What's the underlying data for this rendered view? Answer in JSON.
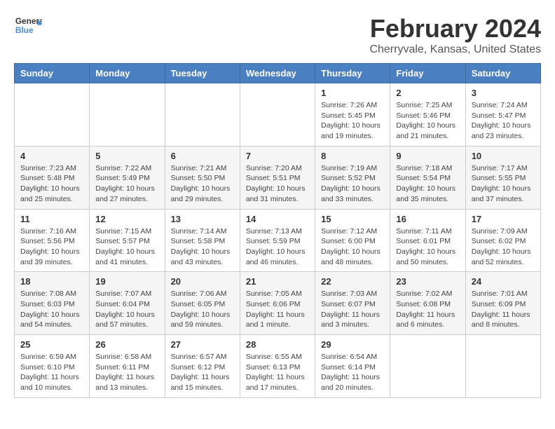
{
  "logo": {
    "line1": "General",
    "line2": "Blue"
  },
  "title": "February 2024",
  "subtitle": "Cherryvale, Kansas, United States",
  "weekdays": [
    "Sunday",
    "Monday",
    "Tuesday",
    "Wednesday",
    "Thursday",
    "Friday",
    "Saturday"
  ],
  "weeks": [
    [
      {
        "day": "",
        "info": ""
      },
      {
        "day": "",
        "info": ""
      },
      {
        "day": "",
        "info": ""
      },
      {
        "day": "",
        "info": ""
      },
      {
        "day": "1",
        "info": "Sunrise: 7:26 AM\nSunset: 5:45 PM\nDaylight: 10 hours and 19 minutes."
      },
      {
        "day": "2",
        "info": "Sunrise: 7:25 AM\nSunset: 5:46 PM\nDaylight: 10 hours and 21 minutes."
      },
      {
        "day": "3",
        "info": "Sunrise: 7:24 AM\nSunset: 5:47 PM\nDaylight: 10 hours and 23 minutes."
      }
    ],
    [
      {
        "day": "4",
        "info": "Sunrise: 7:23 AM\nSunset: 5:48 PM\nDaylight: 10 hours and 25 minutes."
      },
      {
        "day": "5",
        "info": "Sunrise: 7:22 AM\nSunset: 5:49 PM\nDaylight: 10 hours and 27 minutes."
      },
      {
        "day": "6",
        "info": "Sunrise: 7:21 AM\nSunset: 5:50 PM\nDaylight: 10 hours and 29 minutes."
      },
      {
        "day": "7",
        "info": "Sunrise: 7:20 AM\nSunset: 5:51 PM\nDaylight: 10 hours and 31 minutes."
      },
      {
        "day": "8",
        "info": "Sunrise: 7:19 AM\nSunset: 5:52 PM\nDaylight: 10 hours and 33 minutes."
      },
      {
        "day": "9",
        "info": "Sunrise: 7:18 AM\nSunset: 5:54 PM\nDaylight: 10 hours and 35 minutes."
      },
      {
        "day": "10",
        "info": "Sunrise: 7:17 AM\nSunset: 5:55 PM\nDaylight: 10 hours and 37 minutes."
      }
    ],
    [
      {
        "day": "11",
        "info": "Sunrise: 7:16 AM\nSunset: 5:56 PM\nDaylight: 10 hours and 39 minutes."
      },
      {
        "day": "12",
        "info": "Sunrise: 7:15 AM\nSunset: 5:57 PM\nDaylight: 10 hours and 41 minutes."
      },
      {
        "day": "13",
        "info": "Sunrise: 7:14 AM\nSunset: 5:58 PM\nDaylight: 10 hours and 43 minutes."
      },
      {
        "day": "14",
        "info": "Sunrise: 7:13 AM\nSunset: 5:59 PM\nDaylight: 10 hours and 46 minutes."
      },
      {
        "day": "15",
        "info": "Sunrise: 7:12 AM\nSunset: 6:00 PM\nDaylight: 10 hours and 48 minutes."
      },
      {
        "day": "16",
        "info": "Sunrise: 7:11 AM\nSunset: 6:01 PM\nDaylight: 10 hours and 50 minutes."
      },
      {
        "day": "17",
        "info": "Sunrise: 7:09 AM\nSunset: 6:02 PM\nDaylight: 10 hours and 52 minutes."
      }
    ],
    [
      {
        "day": "18",
        "info": "Sunrise: 7:08 AM\nSunset: 6:03 PM\nDaylight: 10 hours and 54 minutes."
      },
      {
        "day": "19",
        "info": "Sunrise: 7:07 AM\nSunset: 6:04 PM\nDaylight: 10 hours and 57 minutes."
      },
      {
        "day": "20",
        "info": "Sunrise: 7:06 AM\nSunset: 6:05 PM\nDaylight: 10 hours and 59 minutes."
      },
      {
        "day": "21",
        "info": "Sunrise: 7:05 AM\nSunset: 6:06 PM\nDaylight: 11 hours and 1 minute."
      },
      {
        "day": "22",
        "info": "Sunrise: 7:03 AM\nSunset: 6:07 PM\nDaylight: 11 hours and 3 minutes."
      },
      {
        "day": "23",
        "info": "Sunrise: 7:02 AM\nSunset: 6:08 PM\nDaylight: 11 hours and 6 minutes."
      },
      {
        "day": "24",
        "info": "Sunrise: 7:01 AM\nSunset: 6:09 PM\nDaylight: 11 hours and 8 minutes."
      }
    ],
    [
      {
        "day": "25",
        "info": "Sunrise: 6:59 AM\nSunset: 6:10 PM\nDaylight: 11 hours and 10 minutes."
      },
      {
        "day": "26",
        "info": "Sunrise: 6:58 AM\nSunset: 6:11 PM\nDaylight: 11 hours and 13 minutes."
      },
      {
        "day": "27",
        "info": "Sunrise: 6:57 AM\nSunset: 6:12 PM\nDaylight: 11 hours and 15 minutes."
      },
      {
        "day": "28",
        "info": "Sunrise: 6:55 AM\nSunset: 6:13 PM\nDaylight: 11 hours and 17 minutes."
      },
      {
        "day": "29",
        "info": "Sunrise: 6:54 AM\nSunset: 6:14 PM\nDaylight: 11 hours and 20 minutes."
      },
      {
        "day": "",
        "info": ""
      },
      {
        "day": "",
        "info": ""
      }
    ]
  ]
}
